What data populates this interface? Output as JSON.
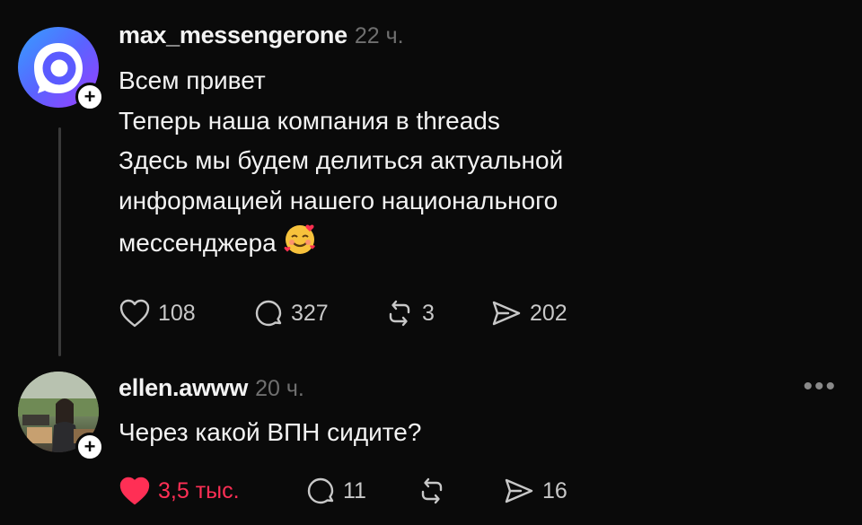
{
  "posts": [
    {
      "username": "max_messengerone",
      "time": "22 ч.",
      "lines": [
        "Всем привет",
        "Теперь наша компания в threads",
        "Здесь мы будем делиться актуальной",
        "информацией нашего национального",
        "мессенджера"
      ],
      "emoji": "smiling-face-with-hearts",
      "likes": "108",
      "replies": "327",
      "reposts": "3",
      "shares": "202",
      "liked": false
    },
    {
      "username": "ellen.awww",
      "time": "20 ч.",
      "lines": [
        "Через какой ВПН сидите?"
      ],
      "likes": "3,5 тыс.",
      "replies": "11",
      "reposts": "",
      "shares": "16",
      "liked": true,
      "more": "•••"
    }
  ],
  "colors": {
    "background": "#0a0a0a",
    "text": "#f3f3f3",
    "muted": "#6f6f6f",
    "like_active": "#ff2f55",
    "max_gradient": [
      "#3a8cff",
      "#8a4dff"
    ]
  }
}
